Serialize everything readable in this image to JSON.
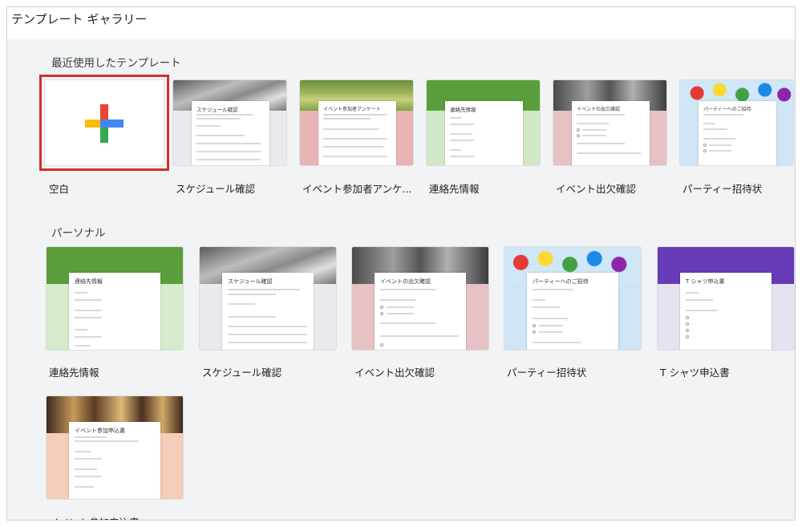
{
  "header": {
    "title": "テンプレート ギャラリー"
  },
  "sections": {
    "recent_title": "最近使用したテンプレート",
    "personal_title": "パーソナル"
  },
  "recent": [
    {
      "label": "空白",
      "selected": true
    },
    {
      "label": "スケジュール確認",
      "sheet_title": "スケジュール確認",
      "color": "#e8eaed"
    },
    {
      "label": "イベント参加者アンケ...",
      "sheet_title": "イベント参加者アンケート",
      "color": "#e8b4b4"
    },
    {
      "label": "連絡先情報",
      "sheet_title": "連絡先情報",
      "color": "#cfe8c7"
    },
    {
      "label": "イベント出欠確認",
      "sheet_title": "イベントの出欠確認",
      "color": "#e6c2c4"
    },
    {
      "label": "パーティー招待状",
      "sheet_title": "パーティーへのご招待",
      "color": "#cfe5f5"
    }
  ],
  "personal": [
    {
      "label": "連絡先情報",
      "sheet_title": "連絡先情報",
      "color": "#d5ebcc"
    },
    {
      "label": "スケジュール確認",
      "sheet_title": "スケジュール確認",
      "color": "#e8eaed"
    },
    {
      "label": "イベント出欠確認",
      "sheet_title": "イベントの出欠確認",
      "color": "#e6c2c4"
    },
    {
      "label": "パーティー招待状",
      "sheet_title": "パーティーへのご招待",
      "color": "#cfe5f5"
    },
    {
      "label": "T シャツ申込書",
      "sheet_title": "T シャツ申込書",
      "color": "#e5e2f1"
    },
    {
      "label": "イベント参加申込書",
      "sheet_title": "イベント参加申込書",
      "color": "#f5cdb8"
    }
  ],
  "colors": {
    "plus_red": "#ea4335",
    "plus_blue": "#4285f4",
    "plus_yellow": "#fbbc05",
    "plus_green": "#34a853",
    "selection": "#d32f2f"
  }
}
